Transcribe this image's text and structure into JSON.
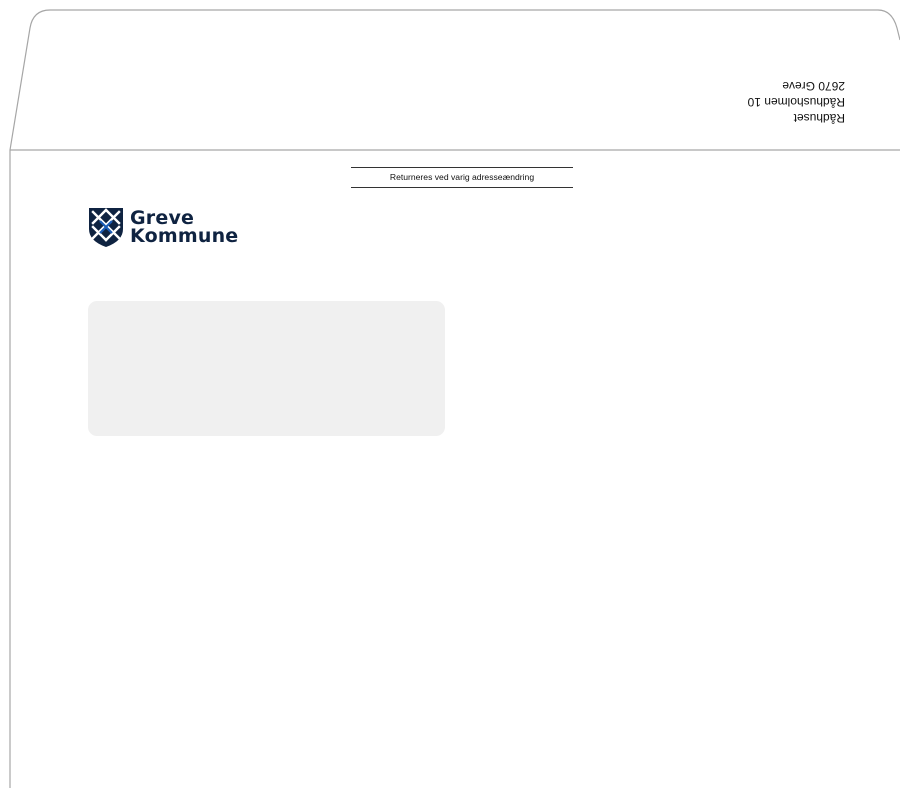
{
  "sender": {
    "lines": [
      "Rådhuset",
      "Rådhusholmen 10",
      "2670 Greve"
    ]
  },
  "return_notice": "Returneres ved varig adresseændring",
  "logo": {
    "line1": "Greve",
    "line2": "Kommune",
    "icon": "greve-shield-icon"
  },
  "colors": {
    "logo_navy": "#0f2341",
    "logo_blue": "#1b5db6",
    "window_fill": "#f0f0f0",
    "outline": "#a6a6a6"
  }
}
